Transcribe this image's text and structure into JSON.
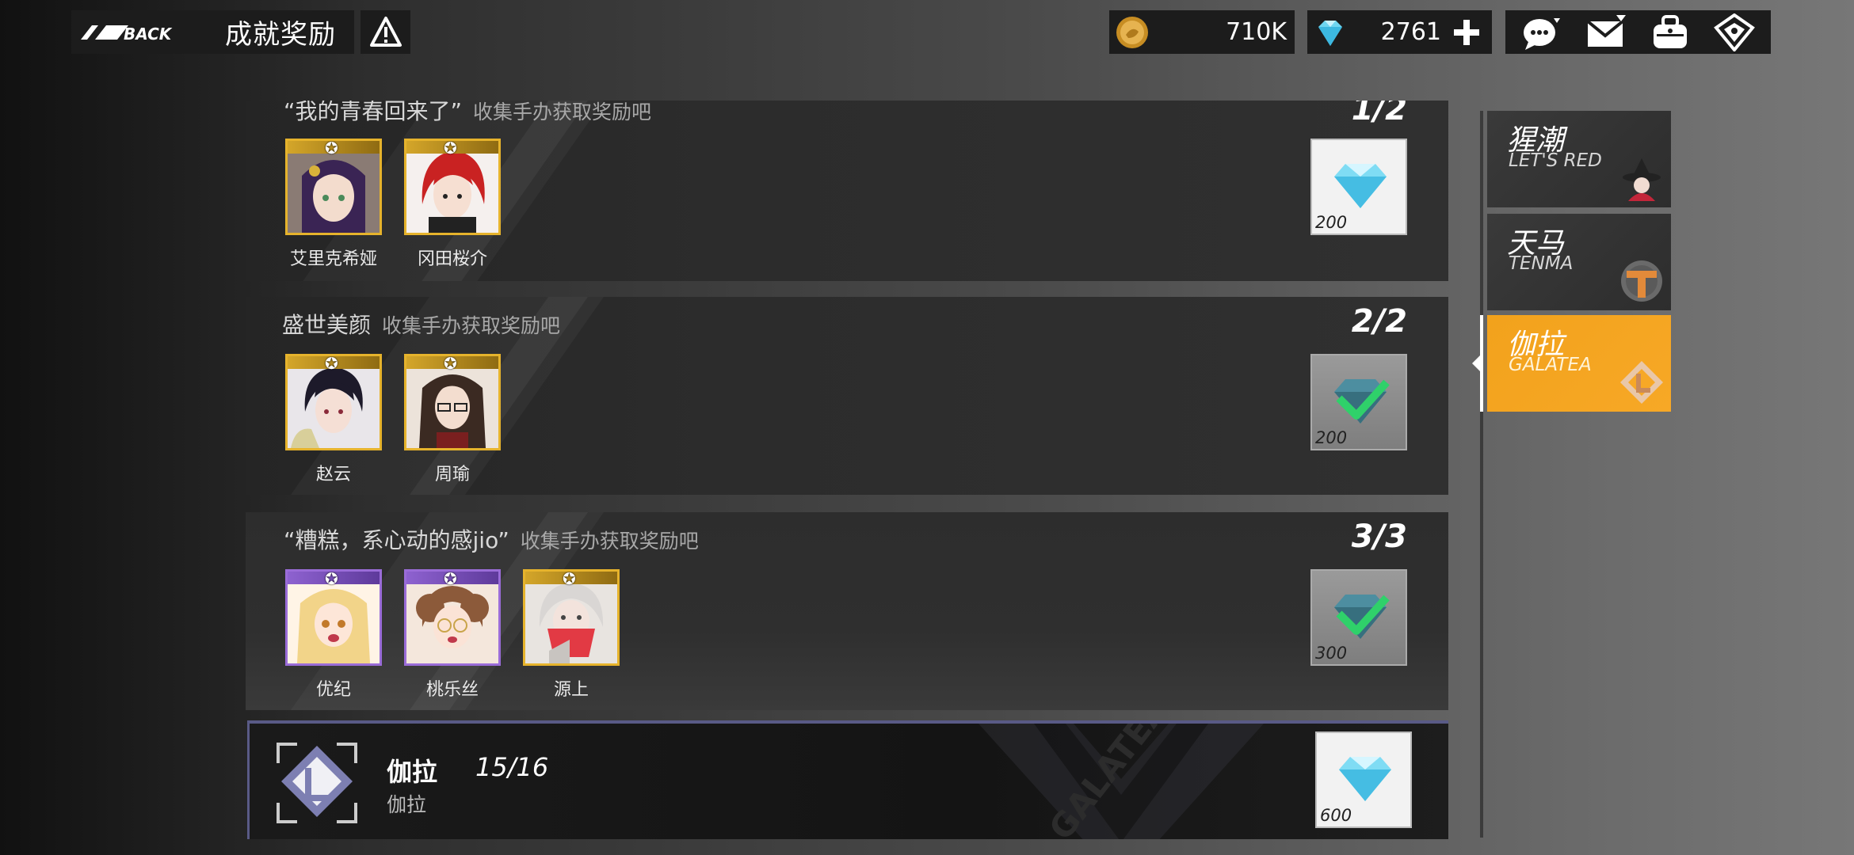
{
  "header": {
    "back_label": "BACK",
    "title": "成就奖励",
    "info_icon": "warning-icon"
  },
  "currency": {
    "gold": {
      "icon": "gold-coin-icon",
      "value": "710K"
    },
    "gem": {
      "icon": "diamond-icon",
      "value": "2761",
      "add_icon": "plus-icon"
    }
  },
  "actions": [
    "chat-icon",
    "mail-icon",
    "bag-icon",
    "rank-icon"
  ],
  "achievements": [
    {
      "title": "“我的青春回来了”",
      "subtitle": "收集手办获取奖励吧",
      "progress": "1/2",
      "figures": [
        {
          "name": "艾里克希娅",
          "rarity": "gold"
        },
        {
          "name": "冈田桜介",
          "rarity": "gold"
        }
      ],
      "reward": {
        "amount": "200",
        "claimed": false
      }
    },
    {
      "title": "盛世美颜",
      "subtitle": "收集手办获取奖励吧",
      "progress": "2/2",
      "figures": [
        {
          "name": "赵云",
          "rarity": "gold"
        },
        {
          "name": "周瑜",
          "rarity": "gold"
        }
      ],
      "reward": {
        "amount": "200",
        "claimed": true
      }
    },
    {
      "title": "“糟糕，系心动的感jio”",
      "subtitle": "收集手办获取奖励吧",
      "progress": "3/3",
      "figures": [
        {
          "name": "优纪",
          "rarity": "purple"
        },
        {
          "name": "桃乐丝",
          "rarity": "purple"
        },
        {
          "name": "源上",
          "rarity": "gold"
        }
      ],
      "reward": {
        "amount": "300",
        "claimed": true
      }
    }
  ],
  "summary": {
    "name": "伽拉",
    "progress": "15/16",
    "subtitle": "伽拉",
    "reward_amount": "600",
    "watermark": "GALATEA"
  },
  "tabs": [
    {
      "cn": "猩潮",
      "en": "LET'S RED",
      "icon": "witch-icon",
      "active": false
    },
    {
      "cn": "天马",
      "en": "TENMA",
      "icon": "tenma-logo-icon",
      "active": false
    },
    {
      "cn": "伽拉",
      "en": "GALATEA",
      "icon": "galatea-logo-icon",
      "active": true
    }
  ],
  "colors": {
    "accent": "#f7a826",
    "gold_frame": "#e6b32c",
    "purple_frame": "#9a6cd8",
    "check_green": "#2fd16a",
    "summary_border": "#595a86"
  }
}
